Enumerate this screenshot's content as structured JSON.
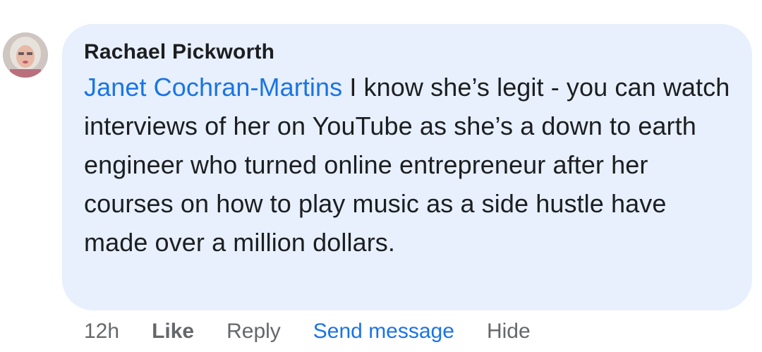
{
  "comment": {
    "author": "Rachael Pickworth",
    "mention": "Janet Cochran-Martins",
    "text": " I know she’s legit - you can watch interviews of her on YouTube as she’s a down to earth engineer who turned online entrepreneur after her courses on how to play music as a side hustle have made over a million dollars.",
    "bubble_color": "#e7f0fc",
    "mention_color": "#1b74e4"
  },
  "actions": {
    "timestamp": "12h",
    "like": "Like",
    "reply": "Reply",
    "send_message": "Send message",
    "hide": "Hide"
  }
}
